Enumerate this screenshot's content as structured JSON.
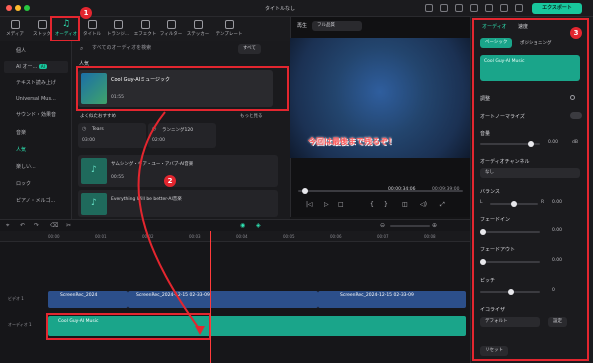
{
  "app": {
    "title": "タイトルなし",
    "export_label": "エクスポート"
  },
  "tabs": [
    {
      "label": "メディア",
      "icon": "media-icon"
    },
    {
      "label": "ストック",
      "icon": "stock-icon"
    },
    {
      "label": "オーディオ",
      "icon": "music-note-icon"
    },
    {
      "label": "タイトル",
      "icon": "title-icon"
    },
    {
      "label": "トランジ...",
      "icon": "transition-icon"
    },
    {
      "label": "エフェクト",
      "icon": "effect-icon"
    },
    {
      "label": "フィルター",
      "icon": "filter-icon"
    },
    {
      "label": "ステッカー",
      "icon": "sticker-icon"
    },
    {
      "label": "テンプレート",
      "icon": "template-icon"
    }
  ],
  "sidebar": {
    "items": [
      {
        "label": "個人"
      },
      {
        "label": "AI オー...",
        "badge": "AI"
      },
      {
        "label": "テキスト読み上げ"
      },
      {
        "label": "Universal Mus..."
      },
      {
        "label": "サウンド・効果音"
      },
      {
        "label": "音楽"
      },
      {
        "label": "人気"
      },
      {
        "label": "楽しい..."
      },
      {
        "label": "ロック"
      },
      {
        "label": "ピアノ・メルゴ..."
      }
    ]
  },
  "library": {
    "search_placeholder": "すべてのオーディオを検索",
    "filter_label": "すべて",
    "section_popular": "人気",
    "featured": {
      "title": "Cool Guy-AIミュージック",
      "duration": "01:55"
    },
    "section_frequent": "よく似たおすすめ",
    "more_label": "もっと見る",
    "frequent": [
      {
        "title": "Tears",
        "duration": "03:00"
      },
      {
        "title": "ランニング120",
        "duration": "02:00"
      }
    ],
    "list": [
      {
        "title": "サムシング・ギア・ユー・アバブ-AI音楽",
        "duration": "00:55"
      },
      {
        "title": "Everything Will be better-AI音楽",
        "duration": ""
      }
    ]
  },
  "player": {
    "label": "再生",
    "quality": "フル品質",
    "subtitle": "今回は最後まで残るぞ！",
    "current_time": "00:00:34:06",
    "total_time": "00:09:39:00"
  },
  "inspector": {
    "tabs": [
      "オーディオ",
      "速度"
    ],
    "subtabs": [
      "ベーシック",
      "ポジショニング"
    ],
    "clip_name": "Cool Guy-AI Music",
    "adjust_label": "調整",
    "auto_normalize": "オートノーマライズ",
    "volume_label": "音量",
    "volume_value": "0.00",
    "volume_unit": "dB",
    "channel_label": "オーディオチャンネル",
    "channel_value": "なし",
    "balance_label": "バランス",
    "balance_value": "0.00",
    "fade_in_label": "フェードイン",
    "fade_in_value": "0.00",
    "fade_out_label": "フェードアウト",
    "fade_out_value": "0.00",
    "pitch_label": "ピッチ",
    "pitch_value": "0",
    "eq_label": "イコライザ",
    "eq_value": "デフォルト",
    "eq_settings": "設定",
    "reset_label": "リセット"
  },
  "timeline": {
    "ruler": [
      "00:00",
      "00:01",
      "00:02",
      "00:03",
      "00:04",
      "00:05",
      "00:06",
      "00:07",
      "00:08"
    ],
    "video_clips": [
      {
        "label": "ScreenRec_2024"
      },
      {
        "label": "ScreenRec_2024-12-15 02-33-09"
      },
      {
        "label": "ScreenRec_2024-12-15 02-33-09"
      }
    ],
    "audio_clip": "Cool Guy-AI Music",
    "video_track_label": "ビデオ 1",
    "audio_track_label": "オーディオ 1"
  },
  "annotations": {
    "badge1": "1",
    "badge2": "2",
    "badge3": "3"
  },
  "colors": {
    "accent": "#2ee6b4",
    "highlight": "#e3262f",
    "audio_track": "#1aa58a"
  }
}
